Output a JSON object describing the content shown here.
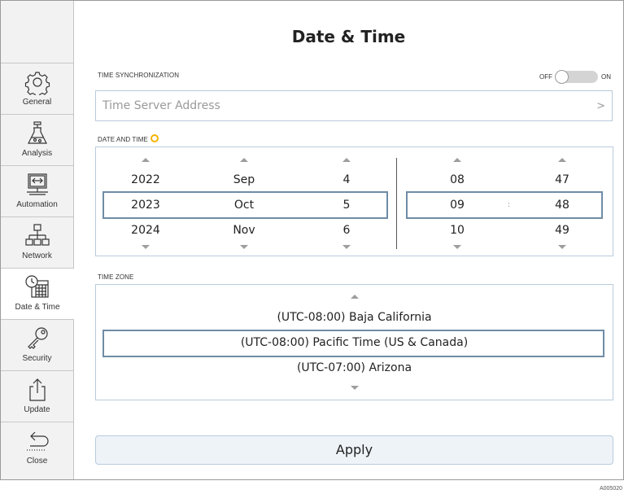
{
  "header": {
    "title": "Date & Time"
  },
  "sidebar": {
    "items": [
      {
        "label": "General",
        "icon": "gear-icon"
      },
      {
        "label": "Analysis",
        "icon": "flask-icon"
      },
      {
        "label": "Automation",
        "icon": "monitor-arrows-icon"
      },
      {
        "label": "Network",
        "icon": "network-tree-icon"
      },
      {
        "label": "Date & Time",
        "icon": "calendar-clock-icon",
        "active": true
      },
      {
        "label": "Security",
        "icon": "key-icon"
      },
      {
        "label": "Update",
        "icon": "upload-icon"
      },
      {
        "label": "Close",
        "icon": "return-arrow-icon"
      }
    ]
  },
  "time_sync": {
    "section_label": "TIME SYNCHRONIZATION",
    "toggle_off": "OFF",
    "toggle_on": "ON",
    "toggle_state": "off",
    "server_placeholder": "Time Server Address",
    "server_chevron": ">"
  },
  "date_time": {
    "section_label": "DATE AND TIME",
    "year": [
      "2022",
      "2023",
      "2024"
    ],
    "month": [
      "Sep",
      "Oct",
      "Nov"
    ],
    "day": [
      "4",
      "5",
      "6"
    ],
    "hour": [
      "08",
      "09",
      "10"
    ],
    "minute": [
      "47",
      "48",
      "49"
    ],
    "separator": ":"
  },
  "time_zone": {
    "section_label": "TIME ZONE",
    "options": [
      "(UTC-08:00) Baja California",
      "(UTC-08:00) Pacific Time (US & Canada)",
      "(UTC-07:00) Arizona"
    ]
  },
  "apply_label": "Apply",
  "figure_code": "A005020",
  "colors": {
    "accent_border": "#6f8ca6",
    "panel_border": "#b9cbdc",
    "indicator": "#f5b400",
    "apply_bg": "#eef3f8"
  }
}
